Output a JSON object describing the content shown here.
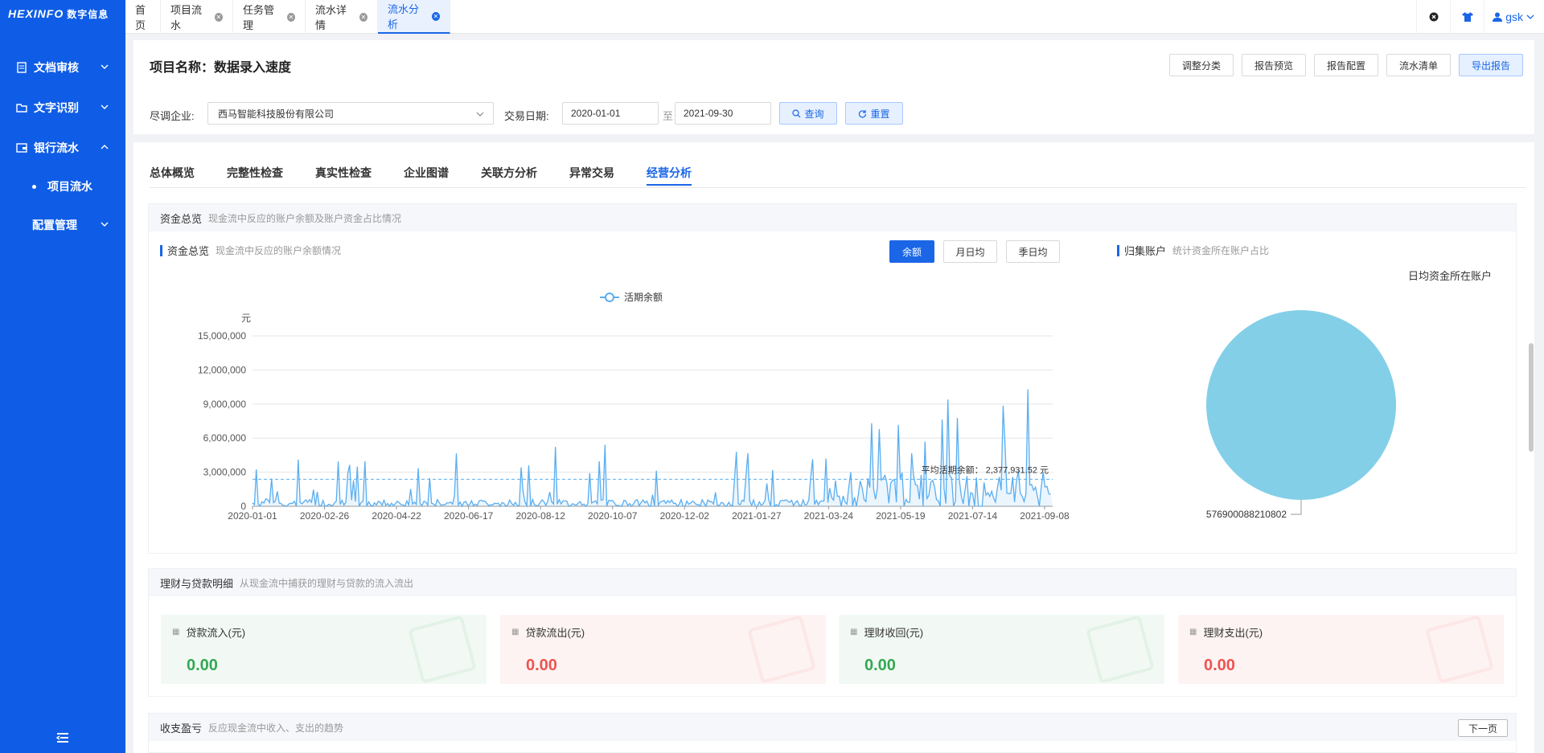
{
  "sidebar": {
    "logo": "HEXINFO",
    "logo_cn": "数字信息",
    "items": [
      {
        "label": "文档审核"
      },
      {
        "label": "文字识别"
      },
      {
        "label": "银行流水"
      },
      {
        "label": "项目流水"
      },
      {
        "label": "配置管理"
      }
    ]
  },
  "tabs": [
    {
      "label": "首页"
    },
    {
      "label": "项目流水"
    },
    {
      "label": "任务管理"
    },
    {
      "label": "流水详情"
    },
    {
      "label": "流水分析"
    }
  ],
  "user": {
    "name": "gsk"
  },
  "header": {
    "title": "项目名称：数据录入速度",
    "buttons": [
      "调整分类",
      "报告预览",
      "报告配置",
      "流水清单",
      "导出报告"
    ]
  },
  "filter": {
    "company_label": "尽调企业:",
    "company_value": "西马智能科技股份有限公司",
    "date_label": "交易日期:",
    "date_from": "2020-01-01",
    "date_sep": "至",
    "date_to": "2021-09-30",
    "query": "查询",
    "reset": "重置"
  },
  "subtabs": [
    "总体概览",
    "完整性检查",
    "真实性检查",
    "企业图谱",
    "关联方分析",
    "异常交易",
    "经营分析"
  ],
  "fund_overview": {
    "title": "资金总览",
    "subtitle": "现金流中反应的账户余额及账户资金占比情况",
    "balance_title": "资金总览",
    "balance_sub": "现金流中反应的账户余额情况",
    "seg": [
      "余额",
      "月日均",
      "季日均"
    ],
    "account_title": "归集账户",
    "account_sub": "统计资金所在账户占比",
    "pie_title": "日均资金所在账户",
    "pie_label": "576900088210802"
  },
  "chart_data": [
    {
      "type": "area",
      "series": [
        {
          "name": "活期余额",
          "color": "#5aaef0"
        }
      ],
      "ylabel": "元",
      "ylim": [
        0,
        15000000
      ],
      "yticks": [
        "15,000,000",
        "12,000,000",
        "9,000,000",
        "6,000,000",
        "3,000,000",
        "0"
      ],
      "xticks": [
        "2020-01-01",
        "2020-02-26",
        "2020-04-22",
        "2020-06-17",
        "2020-08-12",
        "2020-10-07",
        "2020-12-02",
        "2021-01-27",
        "2021-03-24",
        "2021-05-19",
        "2021-07-14",
        "2021-09-08"
      ],
      "avg_line": {
        "label": "平均活期余额：",
        "value": "2,377,931.52 元",
        "y": 2377931.52
      },
      "grid": true,
      "legend": "top"
    },
    {
      "type": "pie",
      "title": "日均资金所在账户",
      "slices": [
        {
          "label": "576900088210802",
          "value": 100,
          "color": "#83cfe8"
        }
      ]
    }
  ],
  "finance": {
    "title": "理财与贷款明细",
    "subtitle": "从现金流中捕获的理财与贷款的流入流出",
    "cards": [
      {
        "label": "贷款流入(元)",
        "value": "0.00"
      },
      {
        "label": "贷款流出(元)",
        "value": "0.00"
      },
      {
        "label": "理财收回(元)",
        "value": "0.00"
      },
      {
        "label": "理财支出(元)",
        "value": "0.00"
      }
    ]
  },
  "profit": {
    "title": "收支盈亏",
    "subtitle": "反应现金流中收入、支出的趋势",
    "next": "下一页"
  },
  "colors": {
    "primary": "#1a66e6",
    "sidebar": "#0f5de6",
    "green": "#34a853",
    "red": "#ef5350"
  }
}
